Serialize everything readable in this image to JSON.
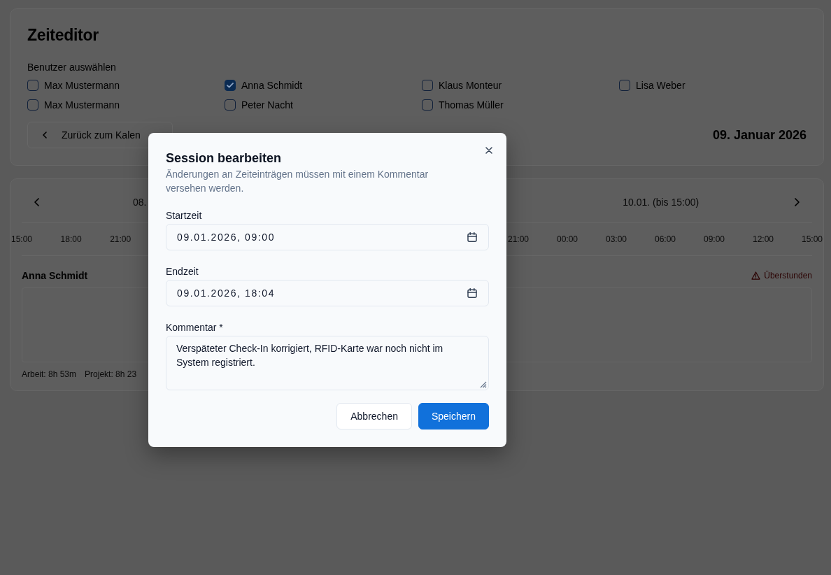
{
  "header": {
    "title": "Zeiteditor",
    "users_label": "Benutzer auswählen",
    "users": [
      {
        "name": "Max Mustermann",
        "checked": false
      },
      {
        "name": "Anna Schmidt",
        "checked": true
      },
      {
        "name": "Klaus Monteur",
        "checked": false
      },
      {
        "name": "Lisa Weber",
        "checked": false
      },
      {
        "name": "Max Mustermann",
        "checked": false
      },
      {
        "name": "Peter Nacht",
        "checked": false
      },
      {
        "name": "Thomas Müller",
        "checked": false
      }
    ],
    "back_button": "Zurück zum Kalen",
    "date": "09. Januar 2026"
  },
  "timeline": {
    "day_label_left": "08.",
    "day_label_right": "10.01. (bis 15:00)",
    "hours_left": [
      "15:00",
      "18:00",
      "21:00"
    ],
    "hours_right": [
      "21:00",
      "00:00",
      "03:00",
      "06:00",
      "09:00",
      "12:00",
      "15:00"
    ],
    "lane": {
      "name": "Anna Schmidt",
      "warning": "Überstunden",
      "work": "Arbeit: 8h 53m",
      "project": "Projekt: 8h 23"
    }
  },
  "dialog": {
    "title": "Session bearbeiten",
    "description": "Änderungen an Zeiteinträgen müssen mit einem Kommentar versehen werden.",
    "fields": [
      {
        "kind": "datetime",
        "label": "Startzeit",
        "value": "09.01.2026, 09:00"
      },
      {
        "kind": "datetime",
        "label": "Endzeit",
        "value": "09.01.2026, 18:04"
      },
      {
        "kind": "comment",
        "label": "Kommentar *",
        "value": "Verspäteter Check-In korrigiert, RFID-Karte war noch nicht im System registriert."
      }
    ],
    "buttons": [
      {
        "kind": "secondary",
        "label": "Abbrechen"
      },
      {
        "kind": "primary",
        "label": "Speichern"
      }
    ]
  }
}
